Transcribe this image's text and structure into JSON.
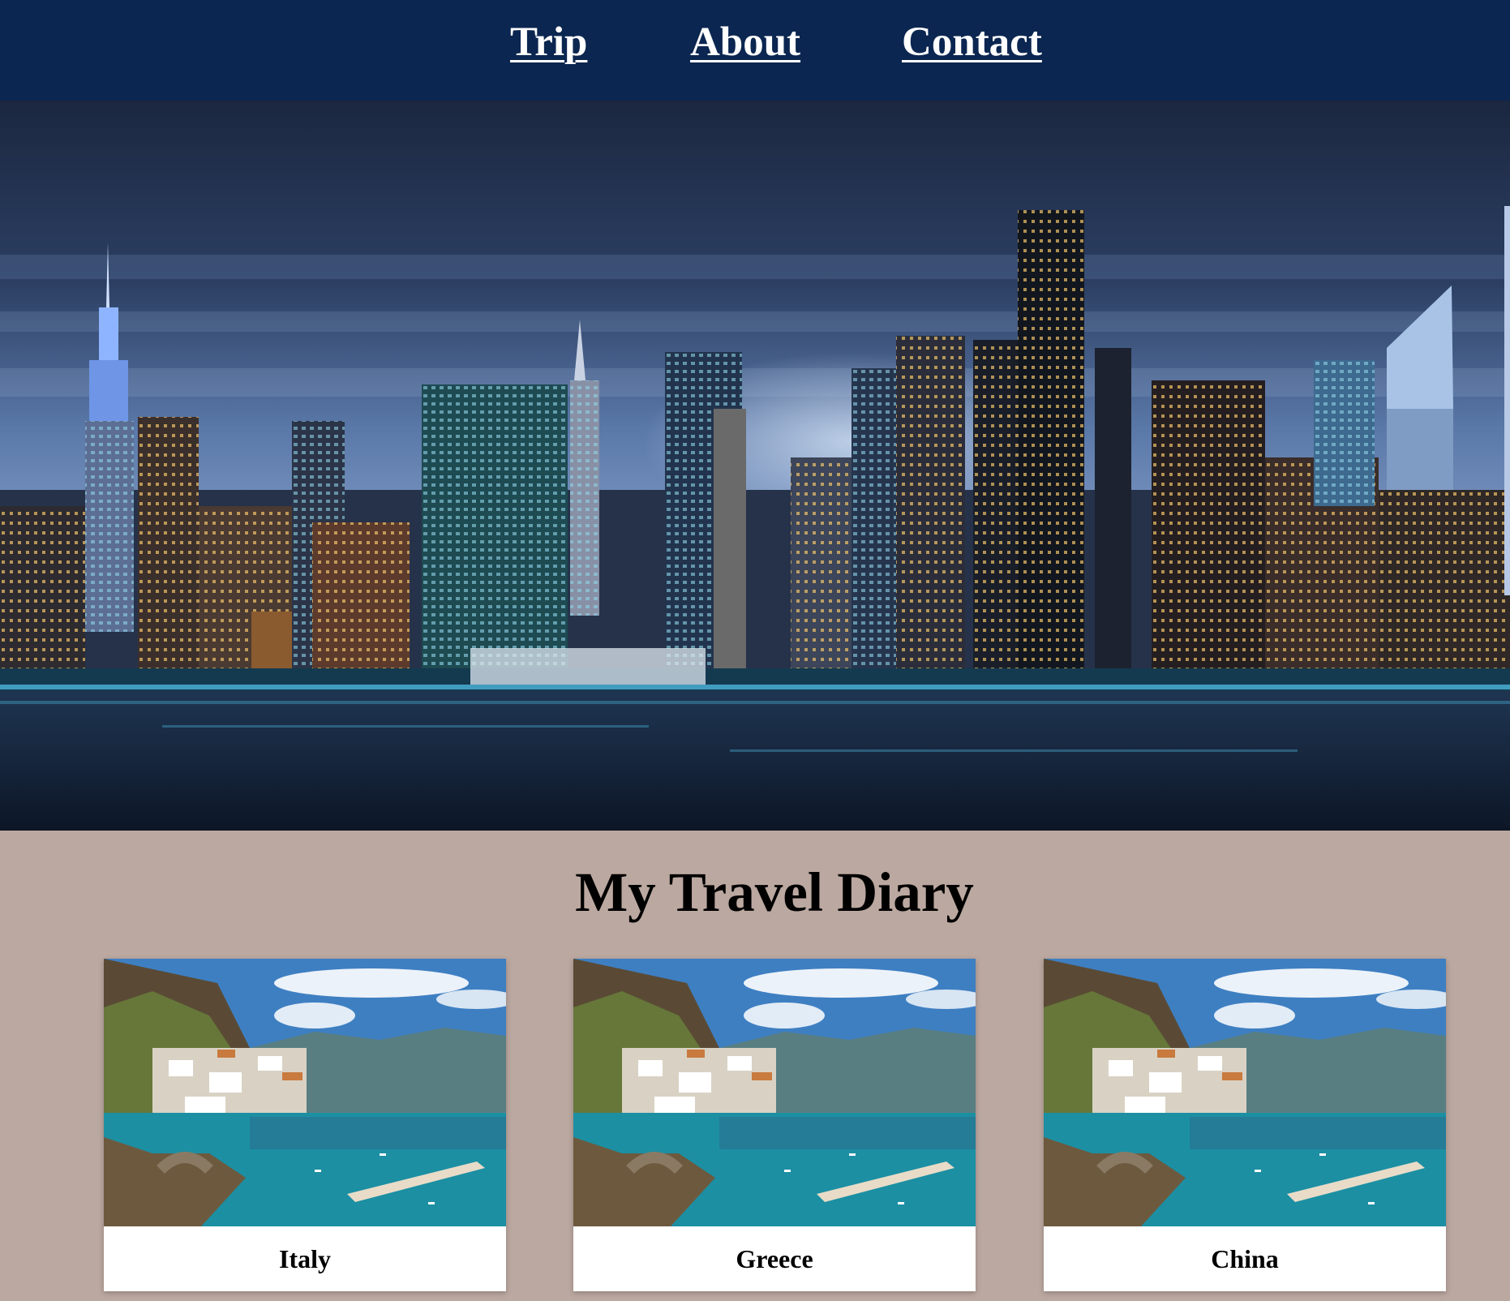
{
  "nav": {
    "items": [
      {
        "label": "Trip"
      },
      {
        "label": "About"
      },
      {
        "label": "Contact"
      }
    ]
  },
  "hero": {
    "image": "city-skyline-night"
  },
  "main": {
    "title": "My Travel Diary",
    "cards": [
      {
        "label": "Italy",
        "image": "coastal-village-photo"
      },
      {
        "label": "Greece",
        "image": "coastal-village-photo"
      },
      {
        "label": "China",
        "image": "coastal-village-photo"
      }
    ]
  },
  "colors": {
    "nav_bg": "#0b2650",
    "page_bg": "#bba8a0",
    "nav_text": "#ffffff",
    "card_bg": "#ffffff"
  }
}
